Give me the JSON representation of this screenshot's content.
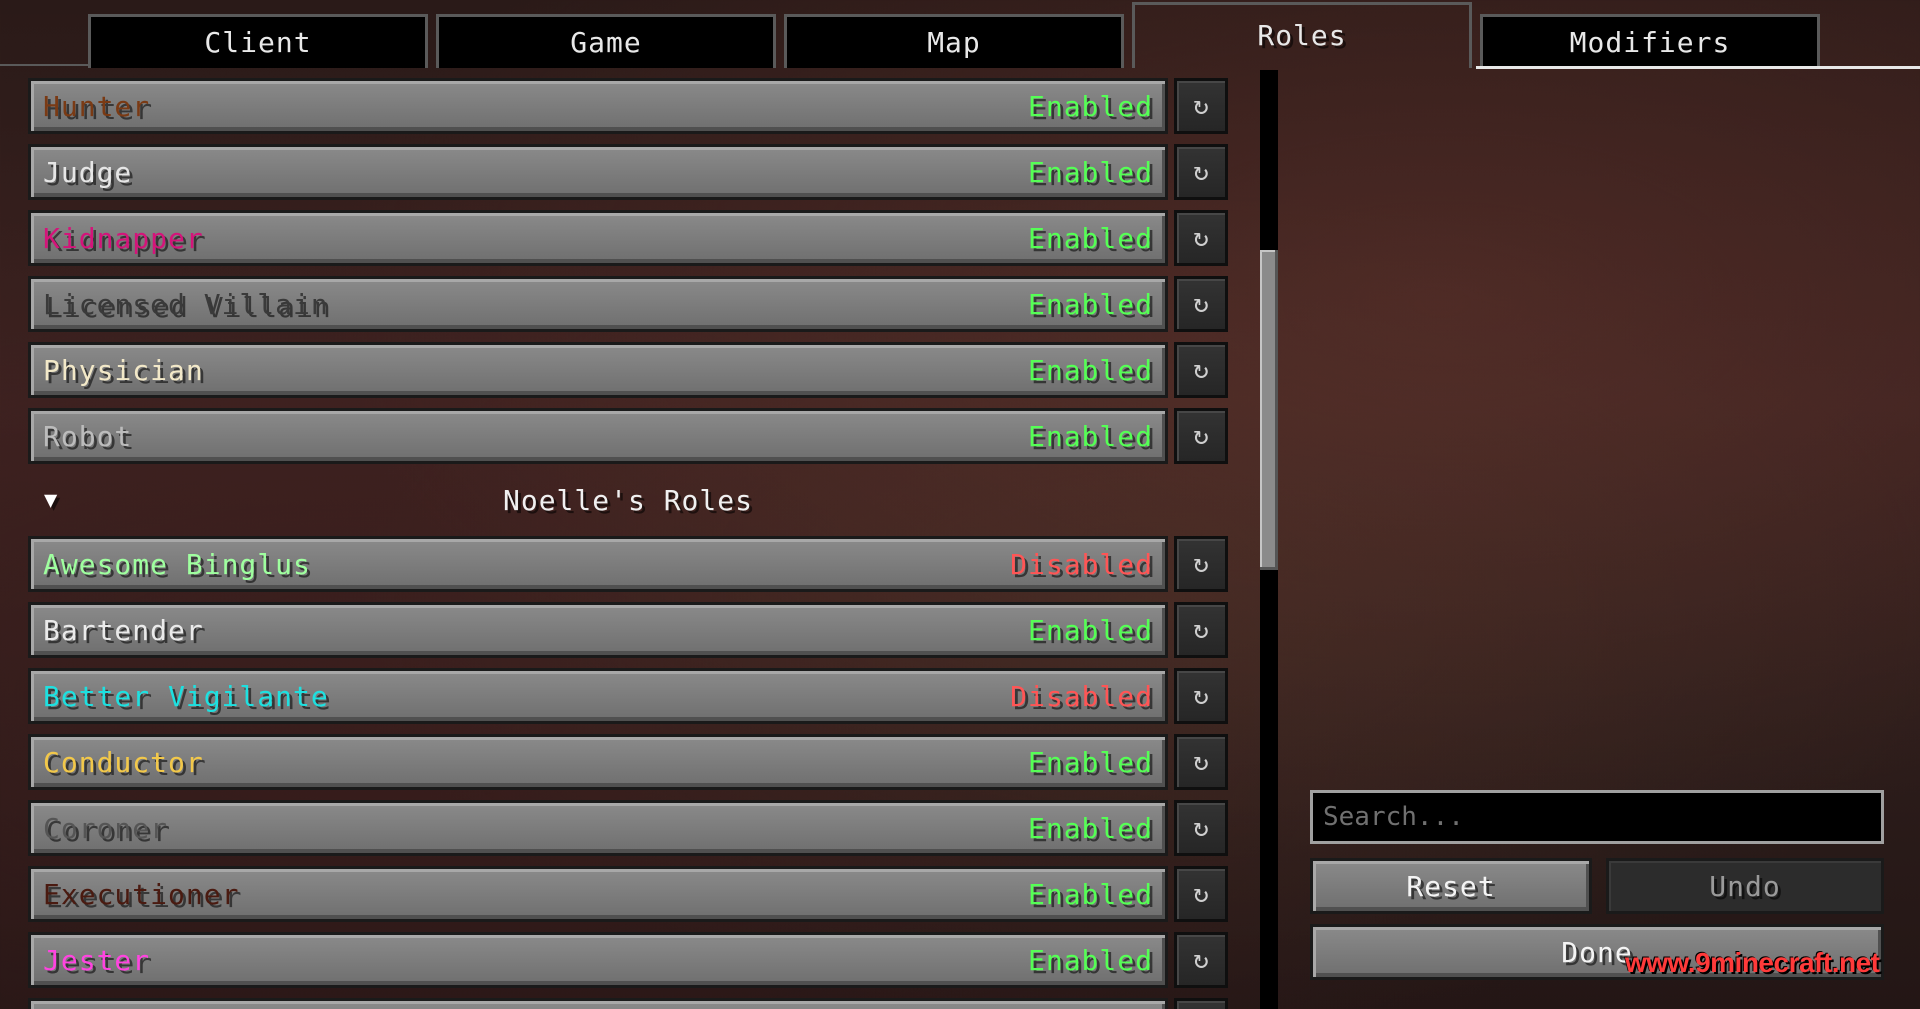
{
  "tabs": [
    {
      "label": "Client",
      "active": false
    },
    {
      "label": "Game",
      "active": false
    },
    {
      "label": "Map",
      "active": false
    },
    {
      "label": "Roles",
      "active": true
    },
    {
      "label": "Modifiers",
      "active": false
    }
  ],
  "roles_top": [
    {
      "name": "Hunter",
      "color": "#7a3a14",
      "status": "Enabled"
    },
    {
      "name": "Judge",
      "color": "#e6e6e6",
      "status": "Enabled"
    },
    {
      "name": "Kidnapper",
      "color": "#d4147a",
      "status": "Enabled"
    },
    {
      "name": "Licensed Villain",
      "color": "#3a3a3a",
      "status": "Enabled"
    },
    {
      "name": "Physician",
      "color": "#f2e8c8",
      "status": "Enabled"
    },
    {
      "name": "Robot",
      "color": "#bcbcbc",
      "status": "Enabled"
    }
  ],
  "category": {
    "label": "Noelle's Roles",
    "arrow": "▼"
  },
  "roles_bottom": [
    {
      "name": "Awesome Binglus",
      "color": "#9fff9f",
      "status": "Disabled"
    },
    {
      "name": "Bartender",
      "color": "#eaeaea",
      "status": "Enabled"
    },
    {
      "name": "Better Vigilante",
      "color": "#1ee0e0",
      "status": "Disabled"
    },
    {
      "name": "Conductor",
      "color": "#f2c84a",
      "status": "Enabled"
    },
    {
      "name": "Coroner",
      "color": "#555555",
      "status": "Enabled"
    },
    {
      "name": "Executioner",
      "color": "#4a1a10",
      "status": "Enabled"
    },
    {
      "name": "Jester",
      "color": "#ff44e0",
      "status": "Enabled"
    }
  ],
  "reset_icon": "↻",
  "search": {
    "placeholder": "Search..."
  },
  "buttons": {
    "reset": "Reset",
    "undo": "Undo",
    "done": "Done"
  },
  "watermark": "www.9minecraft.net"
}
